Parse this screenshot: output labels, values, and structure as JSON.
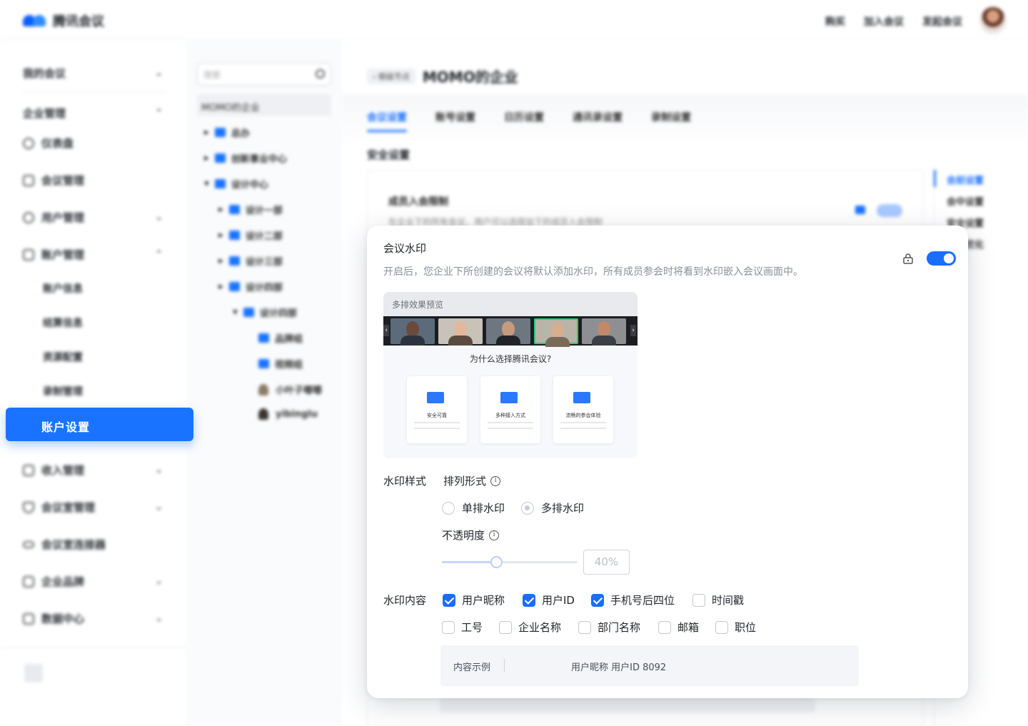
{
  "app": {
    "title": "腾讯会议"
  },
  "topbar": {
    "links": [
      "购买",
      "加入会议",
      "发起会议"
    ]
  },
  "sidebar": {
    "groups": [
      {
        "label": "我的会议",
        "chevron": "⌄"
      },
      {
        "label": "企业管理",
        "chevron": "⌃"
      }
    ],
    "items": [
      {
        "label": "仪表盘",
        "chevron": ""
      },
      {
        "label": "会议管理",
        "chevron": ""
      },
      {
        "label": "用户管理",
        "chevron": "⌄"
      },
      {
        "label": "账户管理",
        "chevron": "⌃"
      }
    ],
    "sub_items": [
      "账户信息",
      "结算信息",
      "资源配置",
      "录制管理"
    ],
    "active_item": "账户设置",
    "more_items": [
      {
        "label": "收入管理",
        "chevron": "⌄"
      },
      {
        "label": "会议室管理",
        "chevron": "⌄"
      },
      {
        "label": "会议室连接器",
        "chevron": ""
      },
      {
        "label": "企业品牌",
        "chevron": "⌄"
      },
      {
        "label": "数据中心",
        "chevron": "⌄"
      }
    ]
  },
  "tree": {
    "search_placeholder": "搜索",
    "root": "MOMO的企业",
    "nodes": [
      {
        "label": "总办"
      },
      {
        "label": "创新事业中心"
      },
      {
        "label": "设计中心"
      },
      {
        "label": "设计一部"
      },
      {
        "label": "设计二部"
      },
      {
        "label": "设计三部"
      },
      {
        "label": "设计四部"
      },
      {
        "label": "设计四部"
      },
      {
        "label": "品牌组"
      },
      {
        "label": "视频组"
      },
      {
        "label": "小叶子嘟嘟"
      },
      {
        "label": "yibinglu"
      }
    ]
  },
  "main": {
    "crumb_tag": "根级节点",
    "title": "MOMO的企业",
    "tabs": [
      "会议设置",
      "账号设置",
      "日历设置",
      "通讯录设置",
      "录制设置"
    ],
    "section_title": "安全设置",
    "bg_card": {
      "title": "成员入会限制",
      "desc": "在企业下的所有会议，用户可以选择加下的成员入会限制"
    },
    "anchors": [
      "会前设置",
      "会中设置",
      "安全设置",
      "网络优化"
    ]
  },
  "watermark": {
    "title": "会议水印",
    "desc": "开启后，您企业下所创建的会议将默认添加水印，所有成员参会时将看到水印嵌入会议画面中。",
    "enabled": true,
    "preview": {
      "header": "多排效果预览",
      "question": "为什么选择腾讯会议?",
      "cards": [
        "安全可靠",
        "多种接入方式",
        "流畅的参会体验"
      ]
    },
    "style_label": "水印样式",
    "layout_label": "排列形式",
    "layout_options": [
      {
        "label": "单排水印",
        "selected": false
      },
      {
        "label": "多排水印",
        "selected": true
      }
    ],
    "opacity_label": "不透明度",
    "opacity_value": "40%",
    "opacity_fraction": 0.4,
    "content_label": "水印内容",
    "content_options": [
      {
        "label": "用户昵称",
        "checked": true
      },
      {
        "label": "用户ID",
        "checked": true
      },
      {
        "label": "手机号后四位",
        "checked": true
      },
      {
        "label": "时间戳",
        "checked": false
      },
      {
        "label": "工号",
        "checked": false
      },
      {
        "label": "企业名称",
        "checked": false
      },
      {
        "label": "部门名称",
        "checked": false
      },
      {
        "label": "邮箱",
        "checked": false
      },
      {
        "label": "职位",
        "checked": false
      }
    ],
    "sample_label": "内容示例",
    "sample_value": "用户昵称 用户ID 8092"
  },
  "colors": {
    "accent": "#1a6dff",
    "active_nav": "#1a73ff"
  }
}
